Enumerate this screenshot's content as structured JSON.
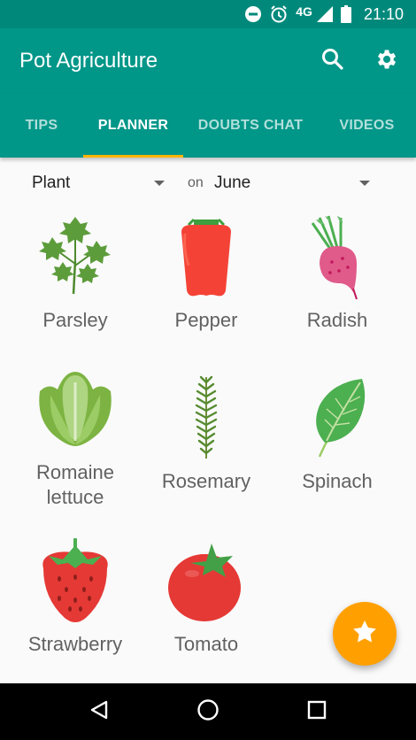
{
  "status_bar": {
    "network": "4G",
    "time": "21:10",
    "icons": [
      "do-not-disturb-icon",
      "alarm-icon",
      "signal-icon",
      "battery-icon"
    ]
  },
  "app_bar": {
    "title": "Pot Agriculture",
    "actions": [
      "search-icon",
      "settings-icon"
    ]
  },
  "tabs": [
    {
      "label": "TIPS",
      "active": false
    },
    {
      "label": "PLANNER",
      "active": true
    },
    {
      "label": "DOUBTS CHAT",
      "active": false
    },
    {
      "label": "VIDEOS",
      "active": false
    }
  ],
  "filters": {
    "plant_select": "Plant",
    "on_label": "on",
    "month_select": "June"
  },
  "plants": [
    {
      "name": "Parsley",
      "icon": "parsley-icon"
    },
    {
      "name": "Pepper",
      "icon": "pepper-icon"
    },
    {
      "name": "Radish",
      "icon": "radish-icon"
    },
    {
      "name": "Romaine lettuce",
      "icon": "romaine-lettuce-icon"
    },
    {
      "name": "Rosemary",
      "icon": "rosemary-icon"
    },
    {
      "name": "Spinach",
      "icon": "spinach-icon"
    },
    {
      "name": "Strawberry",
      "icon": "strawberry-icon"
    },
    {
      "name": "Tomato",
      "icon": "tomato-icon"
    }
  ],
  "fab": {
    "icon": "star-icon"
  },
  "nav_bar": [
    "back-icon",
    "home-icon",
    "recents-icon"
  ],
  "colors": {
    "primary": "#009688",
    "primary_dark": "#00897b",
    "accent": "#ffa000",
    "tab_indicator": "#ffb300"
  }
}
